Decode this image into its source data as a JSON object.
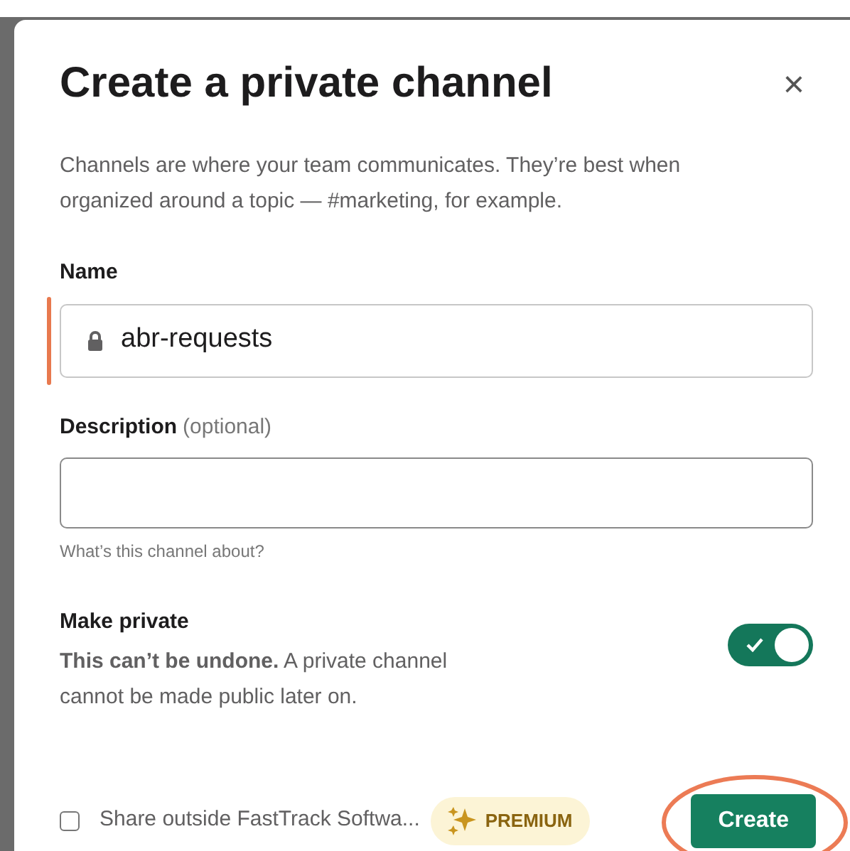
{
  "dialog": {
    "title": "Create a private channel",
    "close_label": "×",
    "intro": "Channels are where your team communicates. They’re best when organized around a topic — #marketing, for example.",
    "name_field": {
      "label": "Name",
      "value": "abr-requests",
      "highlighted": true
    },
    "description_field": {
      "label": "Description",
      "label_note": "(optional)",
      "hint": "What’s this channel about?"
    },
    "make_private": {
      "label": "Make private",
      "text": "**This can’t be undone.** A private channel cannot be made public later on.",
      "on": true
    },
    "share_outside": {
      "label": "Share outside FastTrack Softwa...",
      "checked": false
    },
    "premium_badge": "PREMIUM",
    "create_button": "Create",
    "create_circled": true
  }
}
